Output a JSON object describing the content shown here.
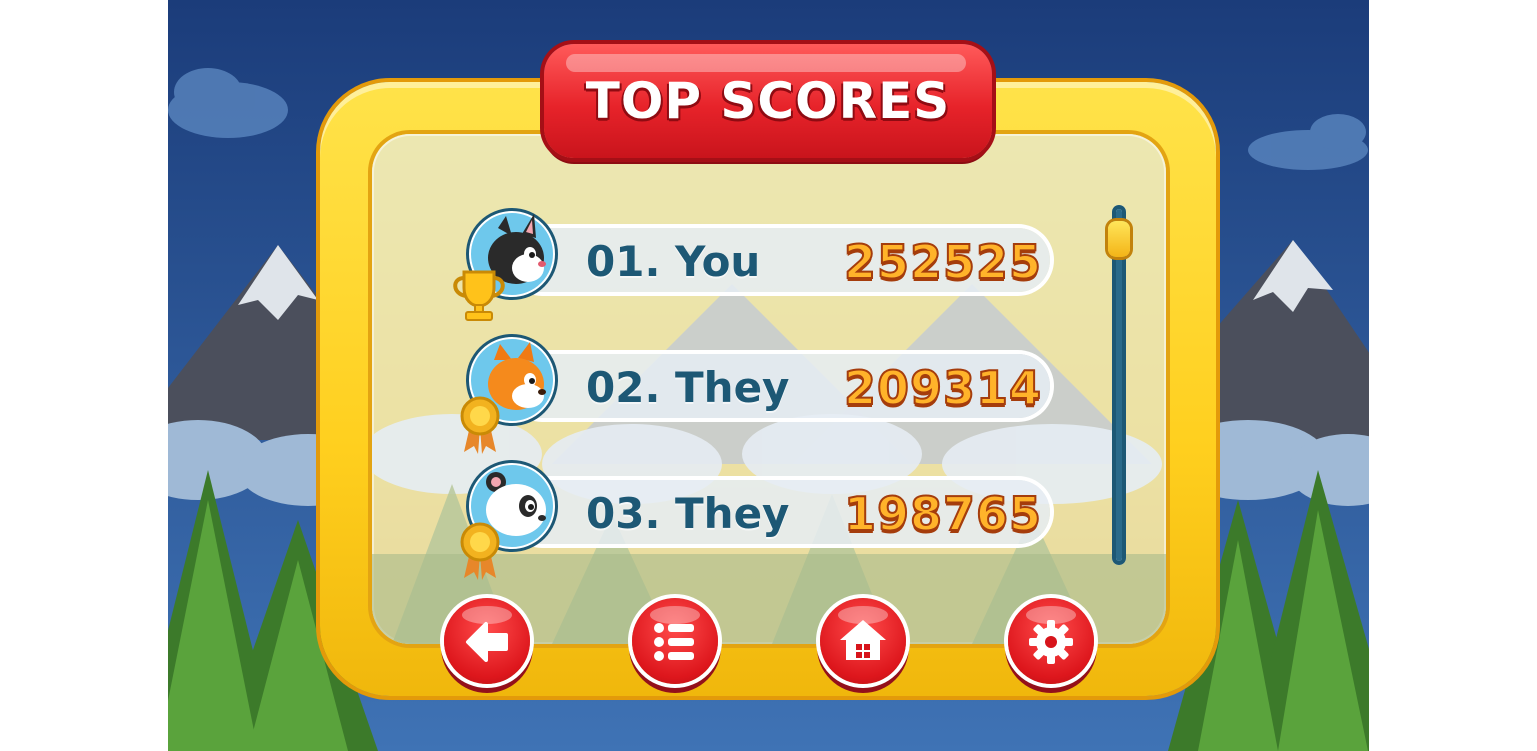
{
  "header": {
    "title": "TOP SCORES"
  },
  "scores": [
    {
      "rank_name": "01. You",
      "score": "252525",
      "character": "cat",
      "badge": "trophy-icon"
    },
    {
      "rank_name": "02. They",
      "score": "209314",
      "character": "fox",
      "badge": "medal-icon"
    },
    {
      "rank_name": "03. They",
      "score": "198765",
      "character": "panda",
      "badge": "medal-icon"
    }
  ],
  "scroll": {
    "position_fraction": 0.05
  },
  "buttons": [
    {
      "icon": "back-arrow-icon"
    },
    {
      "icon": "list-icon"
    },
    {
      "icon": "home-icon"
    },
    {
      "icon": "gear-icon"
    }
  ],
  "colors": {
    "frame": "#ffcf1e",
    "banner": "#e7232a",
    "name_text": "#1d5875",
    "score_text": "#ffb32a",
    "button": "#dd161c"
  }
}
